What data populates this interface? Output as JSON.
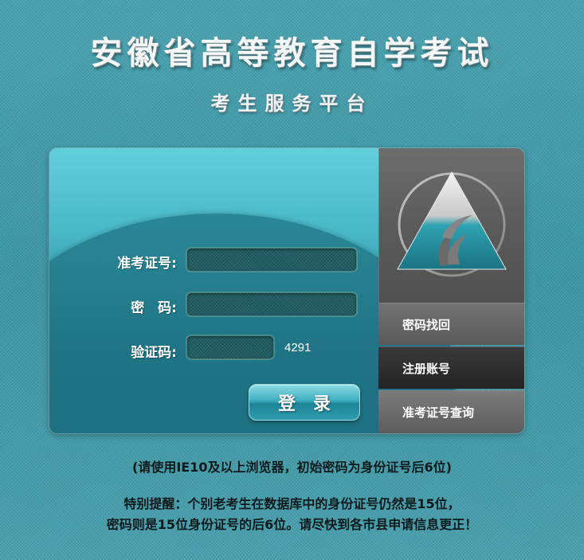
{
  "header": {
    "title": "安徽省高等教育自学考试",
    "subtitle": "考生服务平台"
  },
  "login_form": {
    "exam_id_label": "准考证号:",
    "exam_id_value": "",
    "password_label": "密　码:",
    "password_value": "",
    "captcha_label": "验证码:",
    "captcha_value": "",
    "captcha_code": "4291",
    "submit_label": "登录"
  },
  "sidebar": {
    "logo_icon": "exam-logo-icon",
    "links": [
      {
        "label": "密码找回"
      },
      {
        "label": "注册账号"
      },
      {
        "label": "准考证号查询"
      }
    ]
  },
  "notices": {
    "browser_notice": "(请使用IE10及以上浏览器，初始密码为身份证号后6位)",
    "reminder_line1": "特别提醒：个别老考生在数据库中的身份证号仍然是15位，",
    "reminder_line2": "密码则是15位身份证号的后6位。请尽快到各市县申请信息更正！"
  },
  "colors": {
    "background": "#3f98a6",
    "panel_top": "#62cfdc",
    "panel_bottom": "#1d6f7f",
    "sidebar_gray": "#5b5b5b",
    "sidebar_dark": "#232323"
  }
}
